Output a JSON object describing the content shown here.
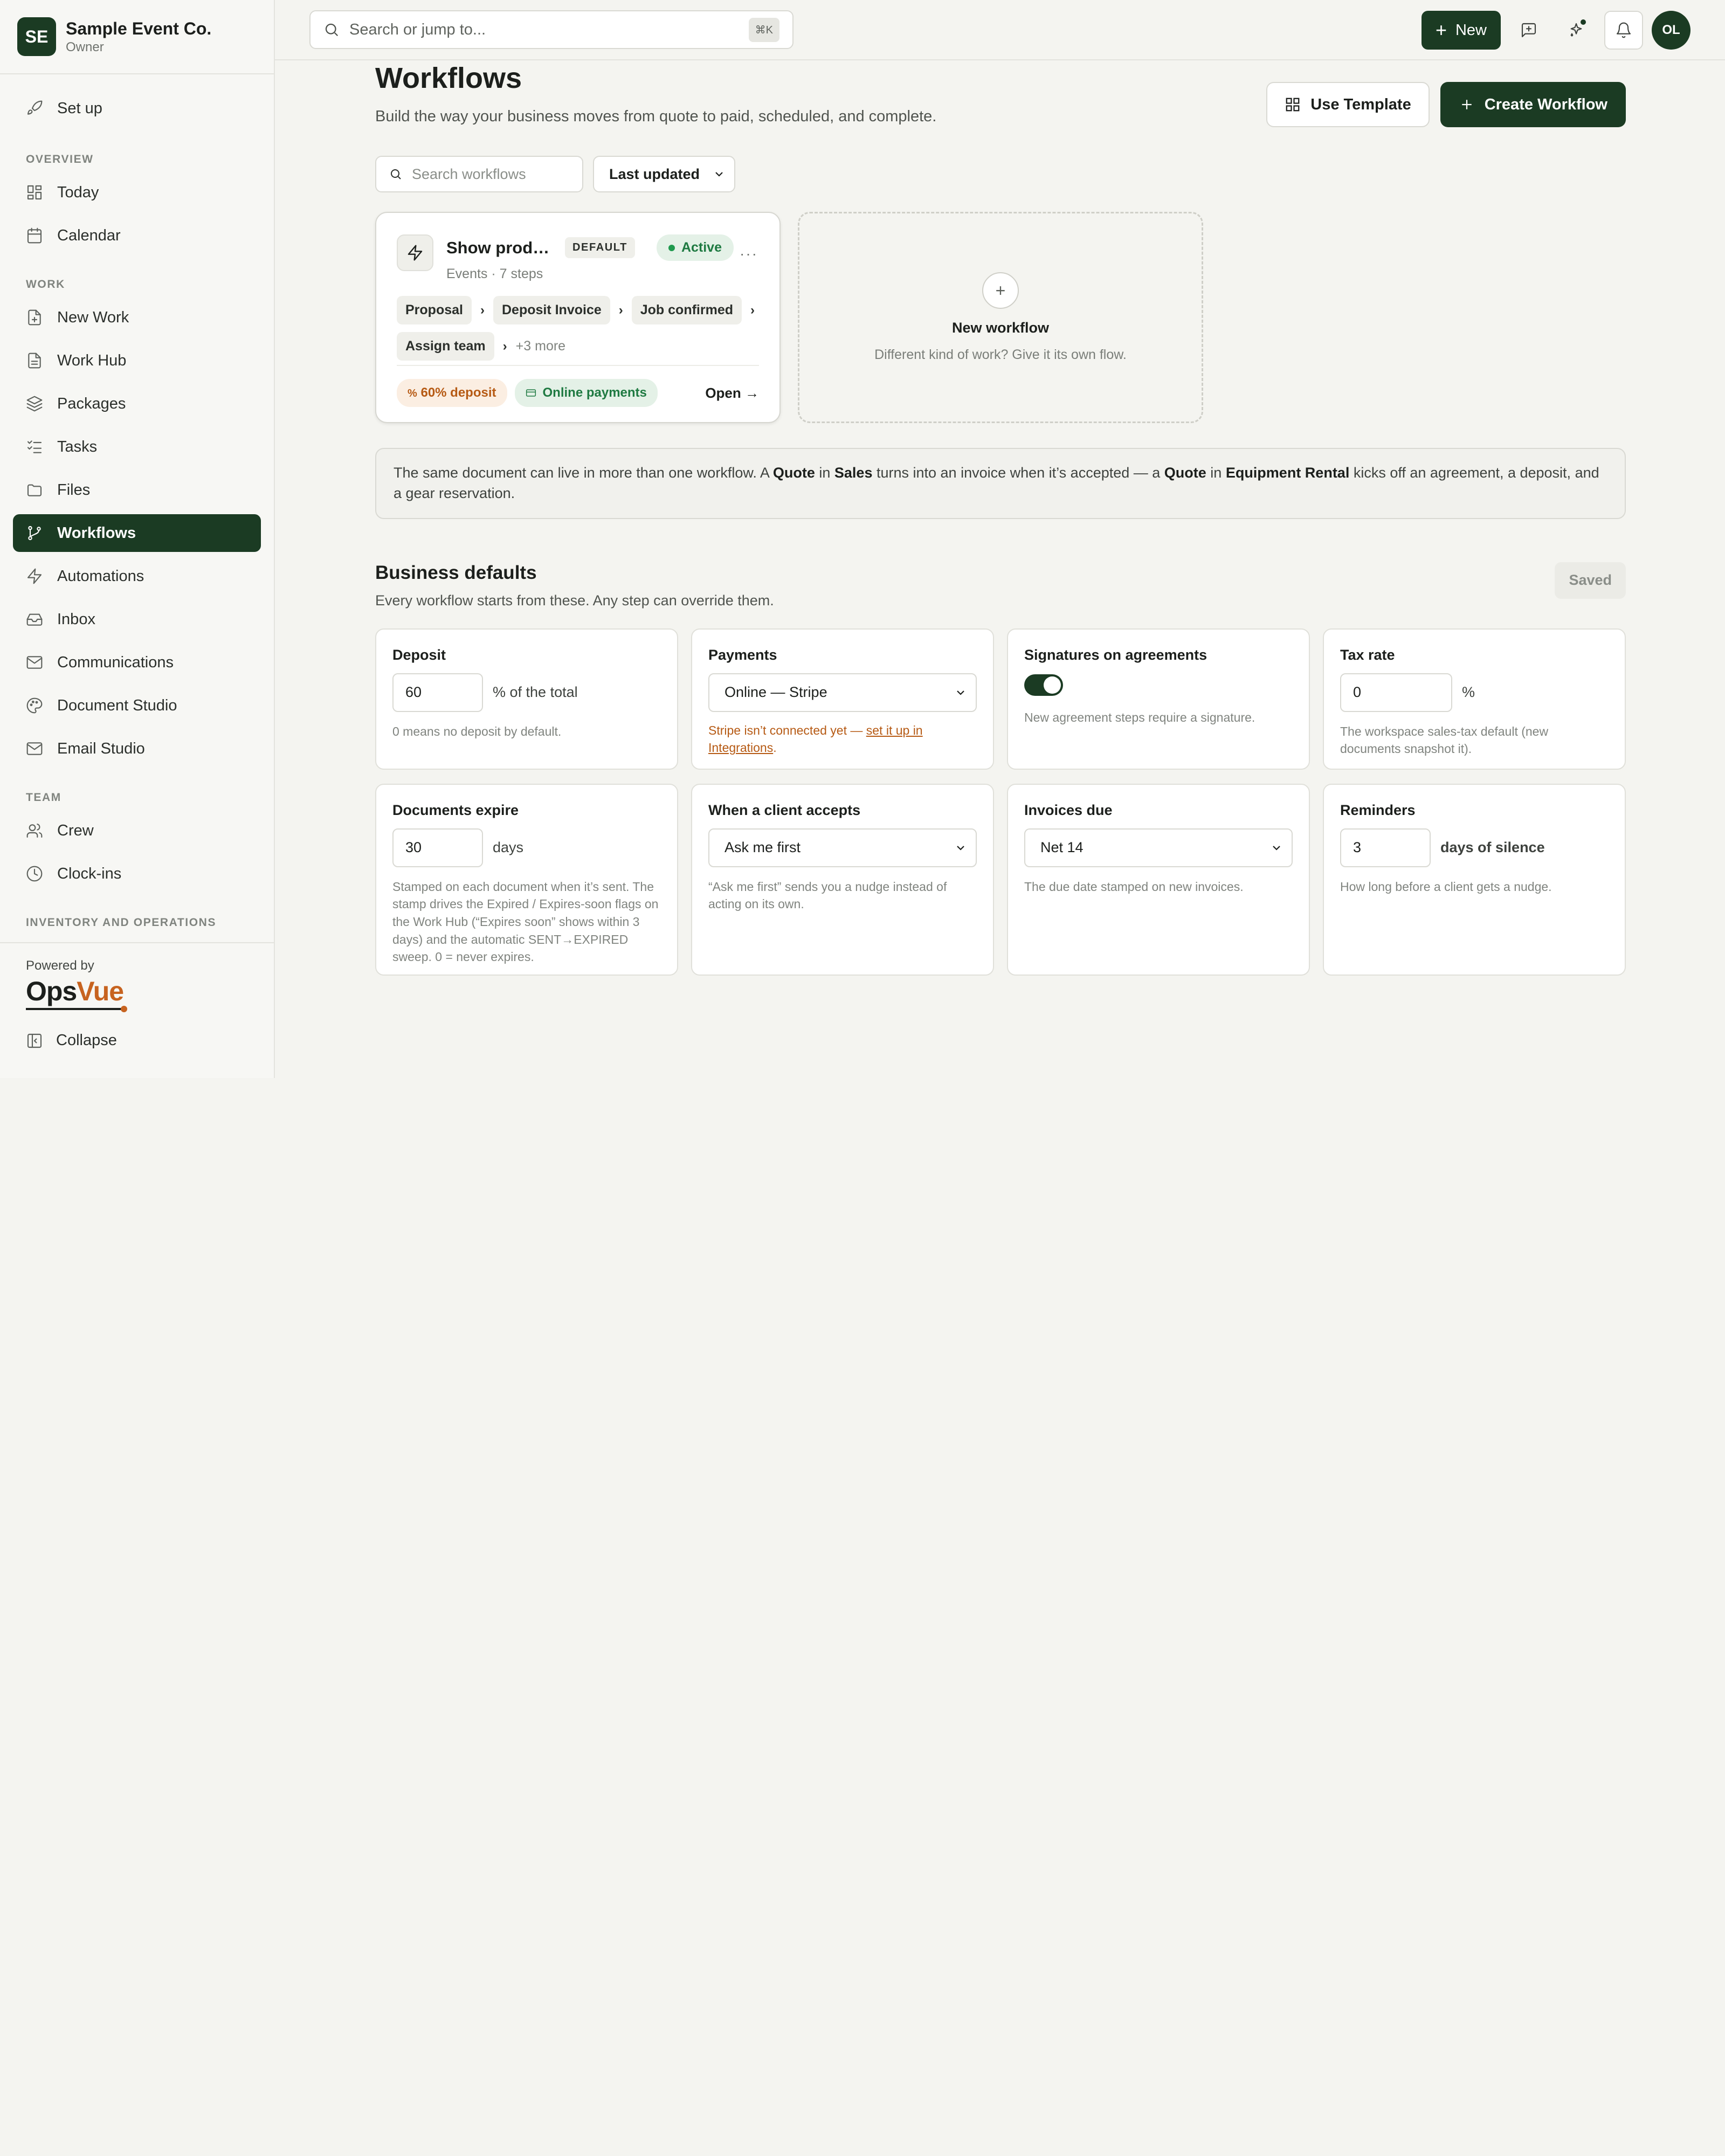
{
  "workspace": {
    "initials": "SE",
    "name": "Sample Event Co.",
    "role": "Owner"
  },
  "sidebar": {
    "setup": "Set up",
    "sections": {
      "overview": "OVERVIEW",
      "work": "WORK",
      "team": "TEAM",
      "inventory": "INVENTORY AND OPERATIONS"
    },
    "items": {
      "today": "Today",
      "calendar": "Calendar",
      "new_work": "New Work",
      "work_hub": "Work Hub",
      "packages": "Packages",
      "tasks": "Tasks",
      "files": "Files",
      "workflows": "Workflows",
      "automations": "Automations",
      "inbox": "Inbox",
      "communications": "Communications",
      "document_studio": "Document Studio",
      "email_studio": "Email Studio",
      "crew": "Crew",
      "clock_ins": "Clock-ins"
    },
    "active": "Workflows",
    "powered_by": "Powered by",
    "brand_ops": "Ops",
    "brand_vue": "Vue",
    "collapse": "Collapse"
  },
  "topbar": {
    "search_placeholder": "Search or jump to...",
    "shortcut": "⌘K",
    "new_label": "New",
    "avatar_initials": "OL"
  },
  "page": {
    "title": "Workflows",
    "subtitle": "Build the way your business moves from quote to paid, scheduled, and complete.",
    "use_template": "Use Template",
    "create_workflow": "Create Workflow",
    "search_placeholder": "Search workflows",
    "sort_value": "Last updated"
  },
  "workflow_card": {
    "name": "Show produ...",
    "default_badge": "DEFAULT",
    "status": "Active",
    "meta": "Events · 7 steps",
    "steps": [
      "Proposal",
      "Deposit Invoice",
      "Job confirmed",
      "Assign team"
    ],
    "more": "+3 more",
    "deposit_chip": "60% deposit",
    "payments_chip": "Online payments",
    "open": "Open →"
  },
  "new_workflow": {
    "title": "New workflow",
    "subtitle": "Different kind of work? Give it its own flow."
  },
  "info": {
    "t1": "The same document can live in more than one workflow. A ",
    "b1": "Quote",
    "t2": " in ",
    "b2": "Sales",
    "t3": " turns into an invoice when it’s accepted — a ",
    "b3": "Quote",
    "t4": " in ",
    "b4": "Equipment Rental",
    "t5": " kicks off an agreement, a deposit, and a gear reservation."
  },
  "business_defaults": {
    "title": "Business defaults",
    "subtitle": "Every workflow starts from these. Any step can override them.",
    "saved": "Saved",
    "deposit": {
      "title": "Deposit",
      "value": "60",
      "suffix": "% of the total",
      "help": "0 means no deposit by default."
    },
    "payments": {
      "title": "Payments",
      "value": "Online — Stripe",
      "warn_pre": "Stripe isn’t connected yet — ",
      "warn_link": "set it up in Integrations",
      "warn_post": "."
    },
    "signatures": {
      "title": "Signatures on agreements",
      "enabled": true,
      "help": "New agreement steps require a signature."
    },
    "tax": {
      "title": "Tax rate",
      "value": "0",
      "suffix": "%",
      "help": "The workspace sales-tax default (new documents snapshot it)."
    },
    "expire": {
      "title": "Documents expire",
      "value": "30",
      "suffix": "days",
      "help": "Stamped on each document when it’s sent. The stamp drives the Expired / Expires-soon flags on the Work Hub (“Expires soon” shows within 3 days) and the automatic SENT→EXPIRED sweep. 0 = never expires."
    },
    "accepts": {
      "title": "When a client accepts",
      "value": "Ask me first",
      "help": "“Ask me first” sends you a nudge instead of acting on its own."
    },
    "invoices": {
      "title": "Invoices due",
      "value": "Net 14",
      "help": "The due date stamped on new invoices."
    },
    "reminders": {
      "title": "Reminders",
      "value": "3",
      "suffix": "days of silence",
      "help": "How long before a client gets a nudge."
    }
  }
}
